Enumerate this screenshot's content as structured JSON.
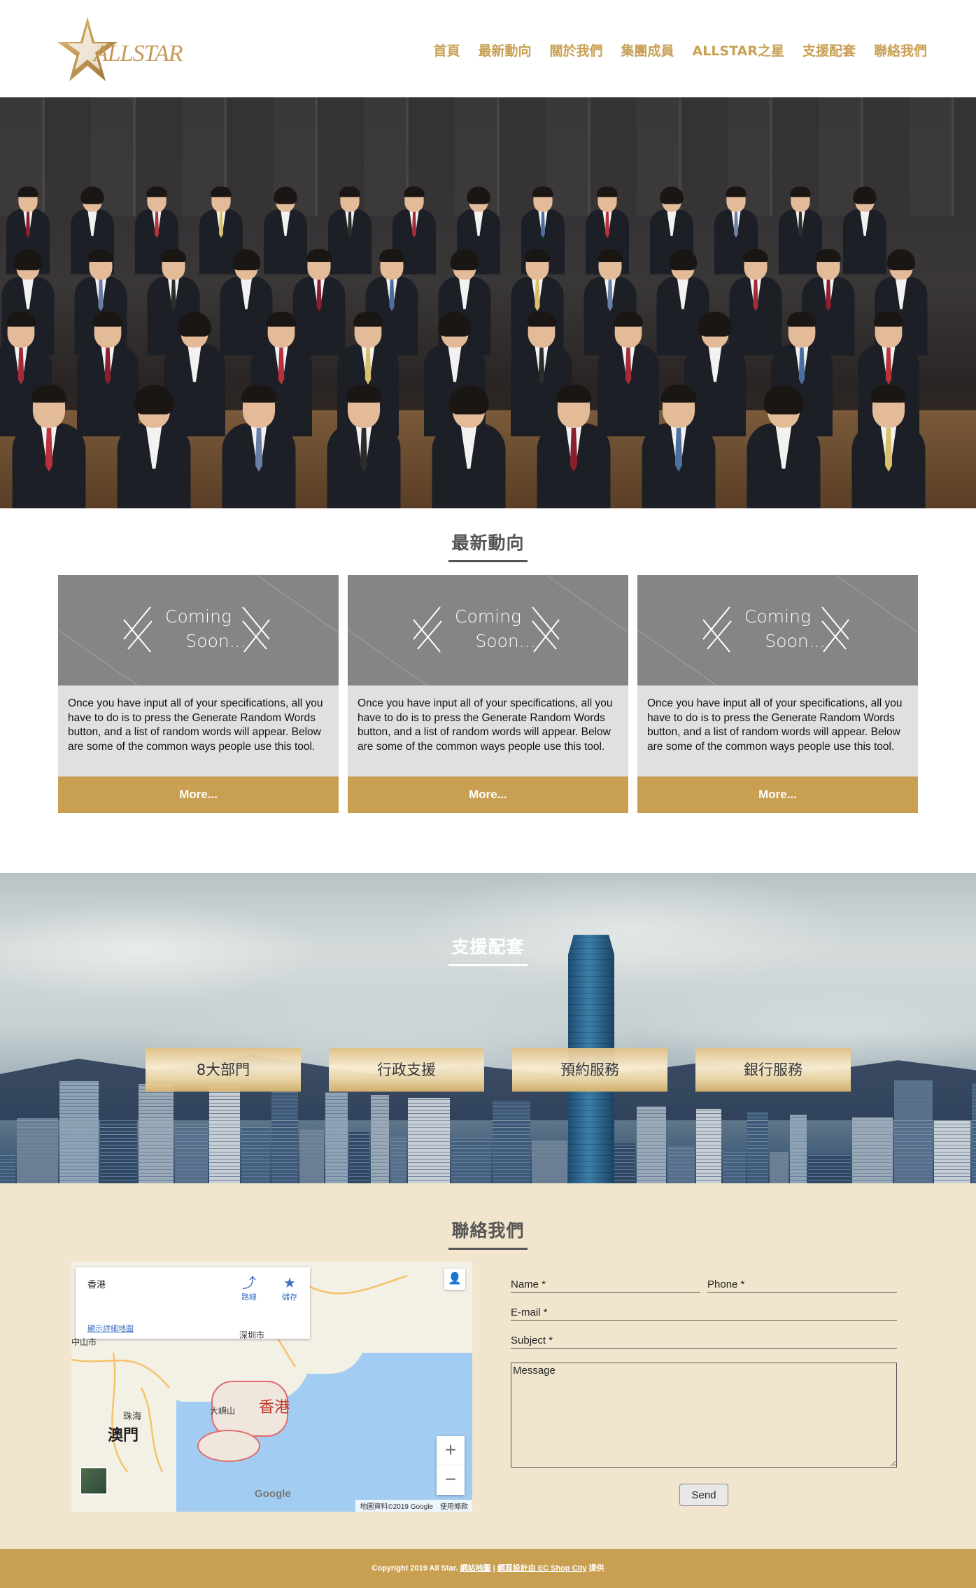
{
  "brand": {
    "logo_text": "ALLSTAR"
  },
  "nav": [
    "首頁",
    "最新動向",
    "關於我們",
    "集團成員",
    "ALLSTAR之星",
    "支援配套",
    "聯絡我們"
  ],
  "news": {
    "title": "最新動向",
    "cards": [
      {
        "img_line1": "Coming",
        "img_line2": "Soon...",
        "text": "Once you have input all of your specifications, all you have to do is to press the Generate Random Words button, and a list of random words will appear. Below are some of the common ways people use this tool.",
        "button": "More..."
      },
      {
        "img_line1": "Coming",
        "img_line2": "Soon...",
        "text": "Once you have input all of your specifications, all you have to do is to press the Generate Random Words button, and a list of random words will appear. Below are some of the common ways people use this tool.",
        "button": "More..."
      },
      {
        "img_line1": "Coming",
        "img_line2": "Soon...",
        "text": "Once you have input all of your specifications, all you have to do is to press the Generate Random Words button, and a list of random words will appear. Below are some of the common ways people use this tool.",
        "button": "More..."
      }
    ]
  },
  "support": {
    "title": "支援配套",
    "buttons": [
      "8大部門",
      "行政支援",
      "預約服務",
      "銀行服務"
    ]
  },
  "contact": {
    "title": "聯絡我們",
    "map": {
      "place_name": "香港",
      "directions_label": "路線",
      "save_label": "儲存",
      "larger_map_link": "顯示詳細地圖",
      "labels": {
        "zhongshan": "中山市",
        "zhuhai": "珠海",
        "macau": "澳門",
        "hongkong": "香港",
        "lantau": "大嶼山",
        "shenzhen": "深圳市"
      },
      "footer_text": "地圖資料©2019 Google　使用條款",
      "google_logo": "Google",
      "zoom_in": "+",
      "zoom_out": "−"
    },
    "form": {
      "name_placeholder": "Name *",
      "phone_placeholder": "Phone *",
      "email_placeholder": "E-mail *",
      "subject_placeholder": "Subject *",
      "message_placeholder": "Message",
      "send_label": "Send"
    }
  },
  "footer": {
    "prefix": "Copyright 2019 All Star.",
    "sitemap_link": "網站地圖",
    "sep": "|",
    "design_link": "網頁設計由 EC Shop City",
    "suffix": "提供"
  },
  "colors": {
    "gold": "#c99f52",
    "contact_bg": "#f1e6cd"
  }
}
